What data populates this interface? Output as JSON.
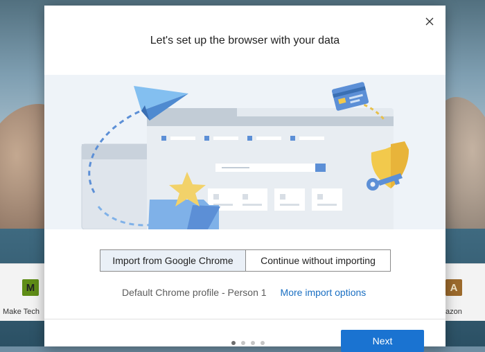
{
  "dialog": {
    "title": "Let's set up the browser with your data",
    "close_icon": "close-icon"
  },
  "import_choices": [
    {
      "label": "Import from Google Chrome",
      "selected": true
    },
    {
      "label": "Continue without importing",
      "selected": false
    }
  ],
  "profile": {
    "text": "Default Chrome profile - Person 1",
    "more_options_link": "More import options"
  },
  "pager": {
    "total_steps": 4,
    "current_step": 1
  },
  "footer": {
    "next_label": "Next"
  },
  "background_tiles": {
    "left": {
      "letter": "M",
      "label": "Make Tech"
    },
    "right": {
      "letter": "A",
      "label": "azon"
    }
  },
  "colors": {
    "accent": "#1a73d1",
    "link": "#1a6fc2",
    "selected_choice_bg": "#eaf0f7",
    "illustration_bg": "#eef3f8"
  }
}
